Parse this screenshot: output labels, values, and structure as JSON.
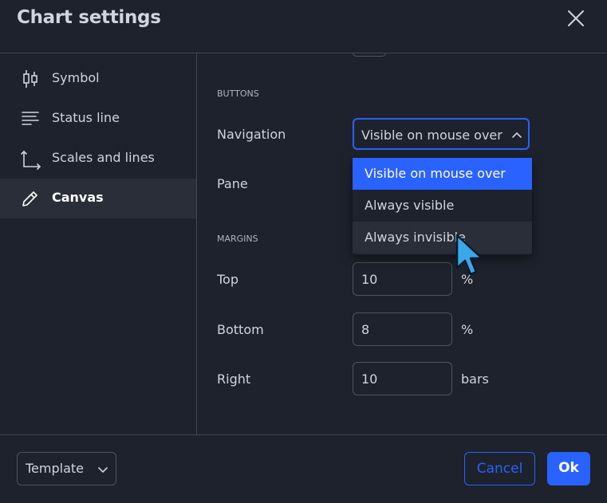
{
  "dialog": {
    "title": "Chart settings"
  },
  "sidebar": {
    "items": [
      {
        "label": "Symbol",
        "icon": "candlestick-icon",
        "active": false
      },
      {
        "label": "Status line",
        "icon": "status-lines-icon",
        "active": false
      },
      {
        "label": "Scales and lines",
        "icon": "scales-icon",
        "active": false
      },
      {
        "label": "Canvas",
        "icon": "pencil-icon",
        "active": true
      }
    ]
  },
  "content": {
    "buttons_section": "BUTTONS",
    "navigation": {
      "label": "Navigation",
      "value": "Visible on mouse over"
    },
    "pane": {
      "label": "Pane"
    },
    "dropdown_options": [
      "Visible on mouse over",
      "Always visible",
      "Always invisible"
    ],
    "margins_section": "MARGINS",
    "margins": [
      {
        "label": "Top",
        "value": "10",
        "unit": "%"
      },
      {
        "label": "Bottom",
        "value": "8",
        "unit": "%"
      },
      {
        "label": "Right",
        "value": "10",
        "unit": "bars"
      }
    ]
  },
  "footer": {
    "template_label": "Template",
    "cancel_label": "Cancel",
    "ok_label": "Ok"
  },
  "colors": {
    "accent": "#2962ff",
    "background": "#1e222d",
    "cursor": "#3aa7e8"
  }
}
